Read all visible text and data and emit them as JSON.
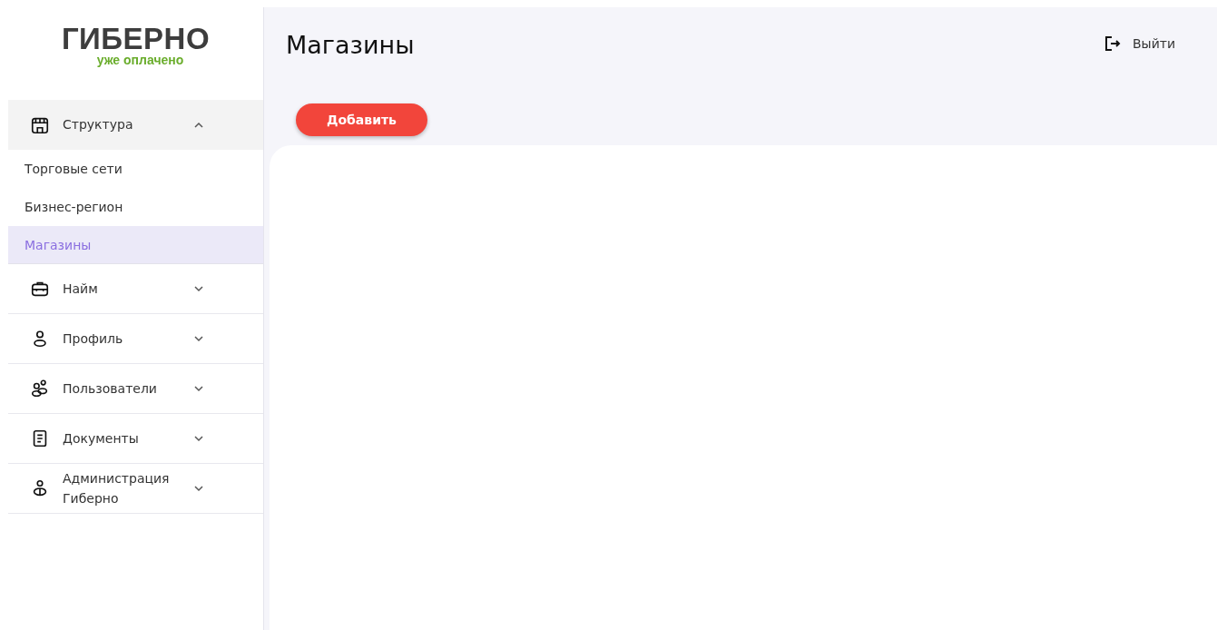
{
  "logo": {
    "name": "ГИБЕРНО",
    "tagline": "уже оплачено"
  },
  "sidebar": {
    "items": [
      {
        "label": "Структура",
        "expanded": true,
        "children": [
          {
            "label": "Торговые сети",
            "selected": false
          },
          {
            "label": "Бизнес-регион",
            "selected": false
          },
          {
            "label": "Магазины",
            "selected": true
          }
        ]
      },
      {
        "label": "Найм",
        "expanded": false
      },
      {
        "label": "Профиль",
        "expanded": false
      },
      {
        "label": "Пользователи",
        "expanded": false
      },
      {
        "label": "Документы",
        "expanded": false
      },
      {
        "label": "Администрация Гиберно",
        "expanded": false
      }
    ]
  },
  "header": {
    "title": "Магазины",
    "logout": "Выйти"
  },
  "add_button": "Добавить"
}
